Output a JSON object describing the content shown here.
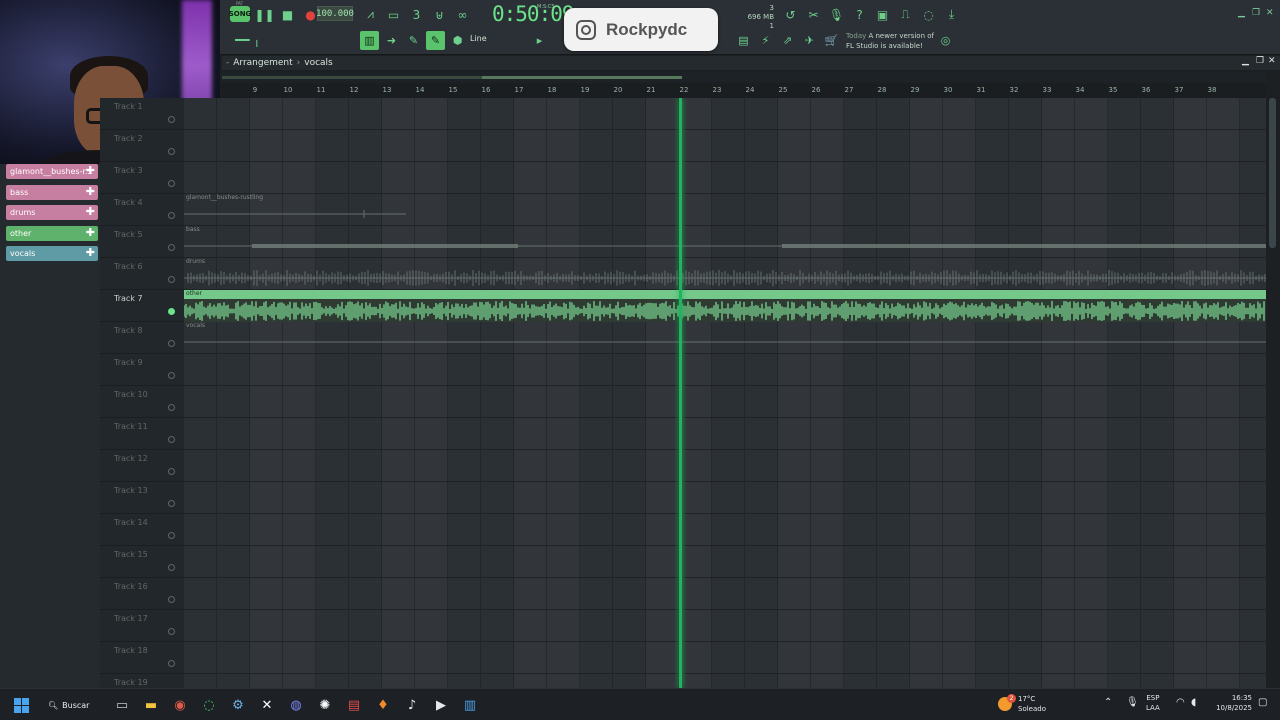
{
  "toolbar": {
    "pat_song_top": "PAT",
    "song_label": "SONG",
    "tempo": "100.000",
    "time": "0:50:09",
    "time_unit": "M:S:CS",
    "pattern_num": "3",
    "memory": "696 MB",
    "cpu_meter": "1",
    "snap_label": "Line",
    "update_today": "Today",
    "update_msg_1": "A newer version of",
    "update_msg_2": "FL Studio is available!"
  },
  "overlay": {
    "instagram_handle": "Rockpydc"
  },
  "playlist": {
    "breadcrumb": [
      "Arrangement",
      "vocals"
    ],
    "ruler_marks": [
      "9",
      "10",
      "11",
      "12",
      "13",
      "14",
      "15",
      "16",
      "17",
      "18",
      "19",
      "20",
      "21",
      "22",
      "23",
      "24",
      "25",
      "26",
      "27",
      "28",
      "29",
      "30",
      "31",
      "32",
      "33",
      "34",
      "35",
      "36",
      "37",
      "38"
    ],
    "tracks": [
      {
        "name": "Track 1"
      },
      {
        "name": "Track 2"
      },
      {
        "name": "Track 3"
      },
      {
        "name": "Track 4"
      },
      {
        "name": "Track 5"
      },
      {
        "name": "Track 6"
      },
      {
        "name": "Track 7"
      },
      {
        "name": "Track 8"
      },
      {
        "name": "Track 9"
      },
      {
        "name": "Track 10"
      },
      {
        "name": "Track 11"
      },
      {
        "name": "Track 12"
      },
      {
        "name": "Track 13"
      },
      {
        "name": "Track 14"
      },
      {
        "name": "Track 15"
      },
      {
        "name": "Track 16"
      },
      {
        "name": "Track 17"
      },
      {
        "name": "Track 18"
      },
      {
        "name": "Track 19"
      }
    ],
    "clips": [
      {
        "label": "glamont__bushes-rustling"
      },
      {
        "label": "bass"
      },
      {
        "label": "drums"
      },
      {
        "label": "other"
      },
      {
        "label": "vocals"
      }
    ]
  },
  "clip_list": [
    {
      "label": "glamont__bushes-r...",
      "color": "#c77fa1"
    },
    {
      "label": "bass",
      "color": "#c77fa1"
    },
    {
      "label": "drums",
      "color": "#c77fa1"
    },
    {
      "label": "other",
      "color": "#5fb26b"
    },
    {
      "label": "vocals",
      "color": "#5f9ba5"
    }
  ],
  "colors": {
    "accent_green": "#6be38a",
    "playhead": "#1fb45e",
    "other_clip": "#74c98a"
  },
  "taskbar": {
    "search_label": "Buscar",
    "weather_temp": "17°C",
    "weather_desc": "Soleado",
    "weather_badge": "2",
    "lang_1": "ESP",
    "lang_2": "LAA",
    "time": "16:35",
    "date": "10/8/2025",
    "apps": [
      "task-view-icon",
      "file-explorer-icon",
      "chrome-icon",
      "whatsapp-icon",
      "app-icon",
      "capcut-icon",
      "discord-icon",
      "chatgpt-icon",
      "video-app-icon",
      "fl-studio-icon",
      "media-icon",
      "media-player-icon",
      "notepad-icon"
    ]
  }
}
